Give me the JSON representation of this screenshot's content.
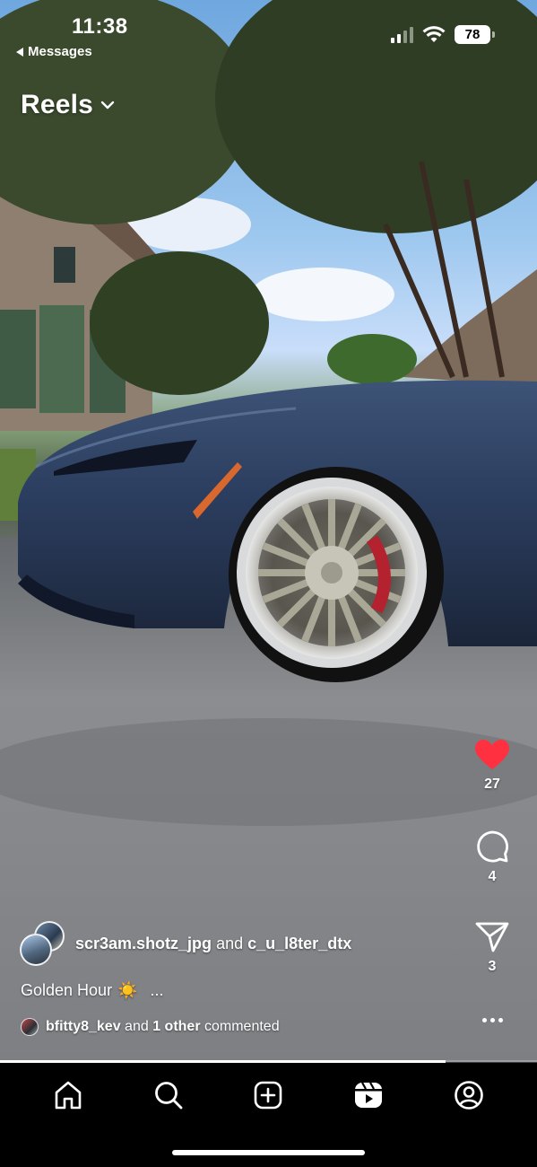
{
  "status_bar": {
    "time": "11:38",
    "back_label": "Messages",
    "battery": "78"
  },
  "header": {
    "title": "Reels"
  },
  "actions": {
    "like_count": "27",
    "comment_count": "4",
    "share_count": "3",
    "like_color": "#ff3040"
  },
  "post": {
    "author_1": "scr3am.shotz_jpg",
    "and_text": "and",
    "author_2": "c_u_l8ter_dtx",
    "caption": "Golden Hour",
    "caption_emoji": "☀️",
    "caption_more": "...",
    "commenter": "bfitty8_kev",
    "comment_and": "and",
    "comment_other": "1 other",
    "comment_suffix": "commented",
    "progress": 0.83
  },
  "nav": {
    "items": [
      "home",
      "search",
      "create",
      "reels",
      "profile"
    ]
  }
}
